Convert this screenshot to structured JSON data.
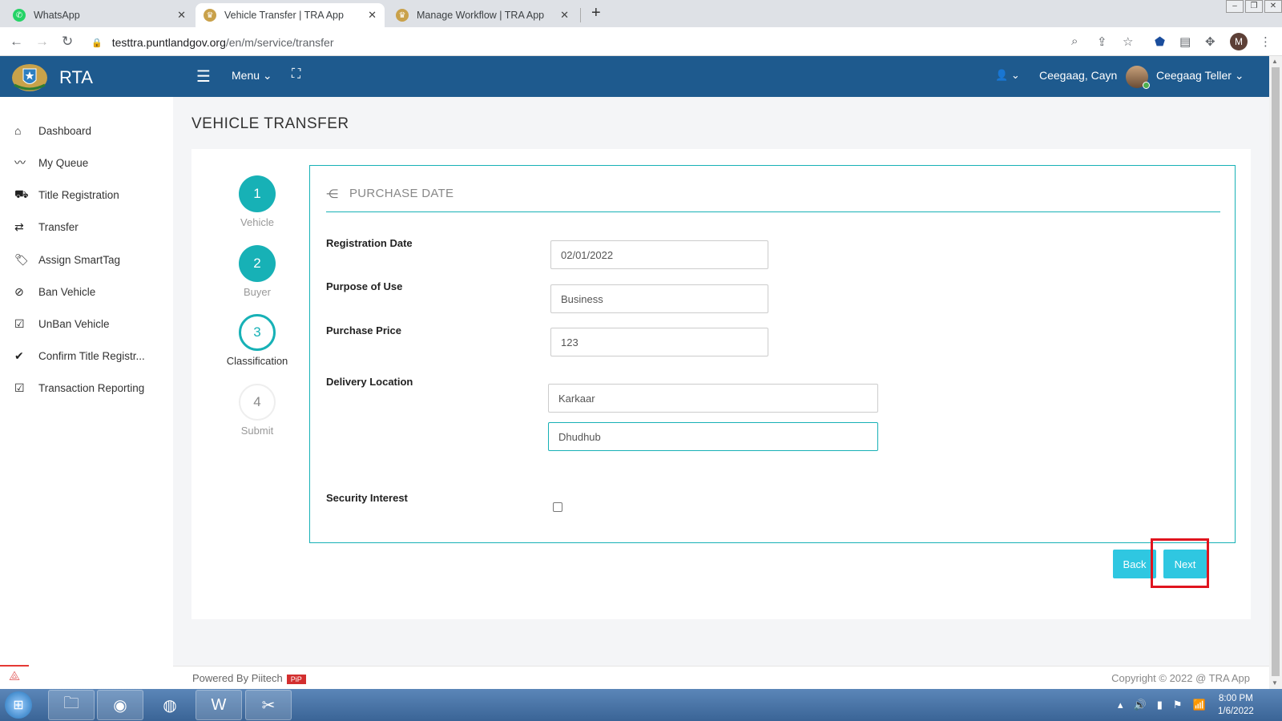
{
  "browser": {
    "tabs": [
      {
        "title": "WhatsApp",
        "active": false
      },
      {
        "title": "Vehicle Transfer | TRA App",
        "active": true
      },
      {
        "title": "Manage Workflow | TRA App",
        "active": false
      }
    ],
    "url_host": "testtra.puntlandgov.org",
    "url_path": "/en/m/service/transfer",
    "profile_initial": "M"
  },
  "header": {
    "brand": "RTA",
    "menu_label": "Menu",
    "user_name": "Ceegaag, Cayn",
    "user_role": "Ceegaag Teller"
  },
  "sidebar": {
    "items": [
      {
        "label": "Dashboard",
        "icon": "home-icon"
      },
      {
        "label": "My Queue",
        "icon": "trend-icon"
      },
      {
        "label": "Title Registration",
        "icon": "car-icon"
      },
      {
        "label": "Transfer",
        "icon": "exchange-icon"
      },
      {
        "label": "Assign SmartTag",
        "icon": "tags-icon"
      },
      {
        "label": "Ban Vehicle",
        "icon": "ban-icon"
      },
      {
        "label": "UnBan Vehicle",
        "icon": "check-square-icon"
      },
      {
        "label": "Confirm Title Registr...",
        "icon": "check-icon"
      },
      {
        "label": "Transaction Reporting",
        "icon": "check-square-icon"
      }
    ]
  },
  "page": {
    "title": "VEHICLE TRANSFER"
  },
  "wizard": {
    "steps": [
      {
        "number": "1",
        "label": "Vehicle",
        "state": "done"
      },
      {
        "number": "2",
        "label": "Buyer",
        "state": "done"
      },
      {
        "number": "3",
        "label": "Classification",
        "state": "current"
      },
      {
        "number": "4",
        "label": "Submit",
        "state": "todo"
      }
    ]
  },
  "form": {
    "section_title": "PURCHASE DATE",
    "registration_date_label": "Registration Date",
    "registration_date_value": "02/01/2022",
    "purpose_label": "Purpose of Use",
    "purpose_value": "Business",
    "price_label": "Purchase Price",
    "price_value": "123",
    "delivery_label": "Delivery Location",
    "delivery_region": "Karkaar",
    "delivery_district": "Dhudhub",
    "security_label": "Security Interest",
    "security_checked": false,
    "back_label": "Back",
    "next_label": "Next"
  },
  "footer": {
    "powered": "Powered By Piitech",
    "badge": "PiP",
    "copyright": "Copyright © 2022 @ TRA App"
  },
  "taskbar": {
    "time": "8:00 PM",
    "date": "1/6/2022"
  },
  "colors": {
    "header_bg": "#1e5a8e",
    "accent_teal": "#17b1b6",
    "button_cyan": "#2fc7e1",
    "highlight_red": "#e0141e"
  }
}
